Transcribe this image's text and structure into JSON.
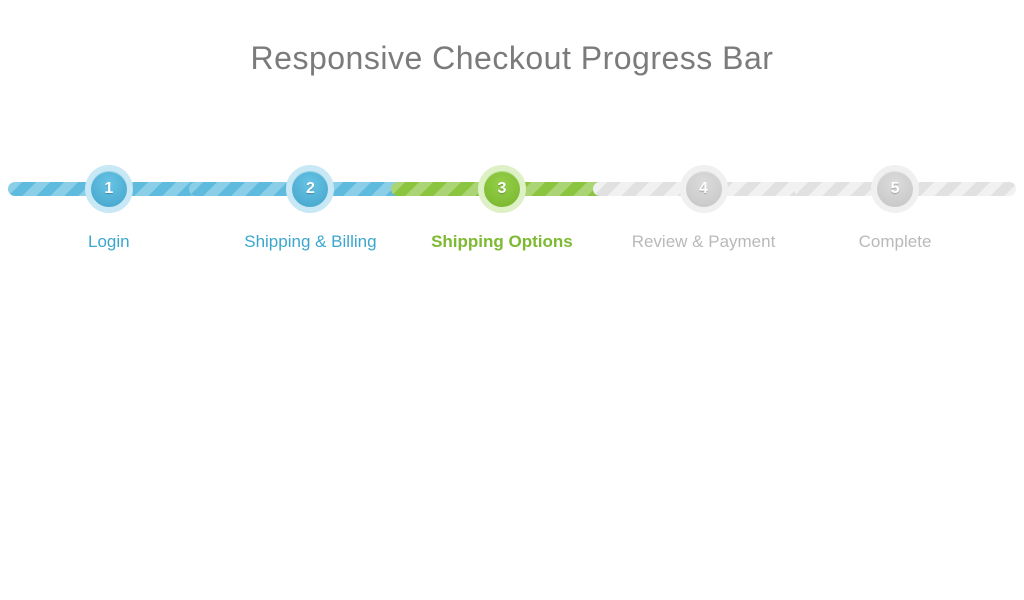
{
  "title": "Responsive Checkout Progress Bar",
  "colors": {
    "visited": "#4aa9cf",
    "current": "#7db932",
    "upcoming": "#c9c9c9"
  },
  "current_step_index": 2,
  "steps": [
    {
      "num": "1",
      "label": "Login",
      "state": "visited"
    },
    {
      "num": "2",
      "label": "Shipping & Billing",
      "state": "visited"
    },
    {
      "num": "3",
      "label": "Shipping Options",
      "state": "current"
    },
    {
      "num": "4",
      "label": "Review & Payment",
      "state": "upcoming"
    },
    {
      "num": "5",
      "label": "Complete",
      "state": "upcoming"
    }
  ]
}
